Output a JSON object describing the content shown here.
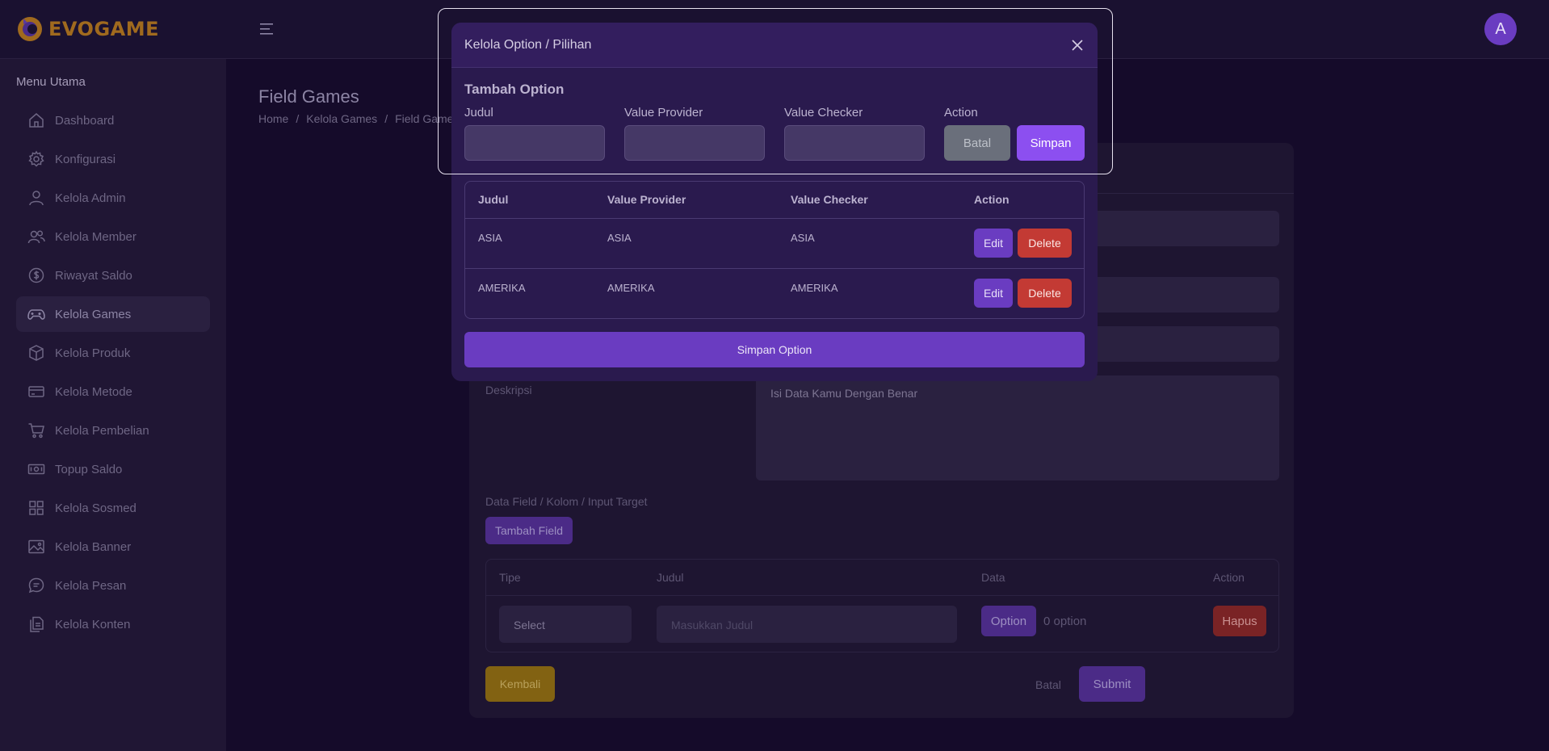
{
  "brand": {
    "name": "EVOGAME"
  },
  "user": {
    "avatar_letter": "A"
  },
  "sidebar": {
    "title": "Menu Utama",
    "items": [
      {
        "label": "Dashboard",
        "icon": "home-icon"
      },
      {
        "label": "Konfigurasi",
        "icon": "gear-icon"
      },
      {
        "label": "Kelola Admin",
        "icon": "user-icon"
      },
      {
        "label": "Kelola Member",
        "icon": "users-icon"
      },
      {
        "label": "Riwayat Saldo",
        "icon": "dollar-icon"
      },
      {
        "label": "Kelola Games",
        "icon": "gamepad-icon",
        "active": true
      },
      {
        "label": "Kelola Produk",
        "icon": "box-icon"
      },
      {
        "label": "Kelola Metode",
        "icon": "card-icon"
      },
      {
        "label": "Kelola Pembelian",
        "icon": "cart-icon"
      },
      {
        "label": "Topup Saldo",
        "icon": "cash-icon"
      },
      {
        "label": "Kelola Sosmed",
        "icon": "grid-icon"
      },
      {
        "label": "Kelola Banner",
        "icon": "image-icon"
      },
      {
        "label": "Kelola Pesan",
        "icon": "chat-icon"
      },
      {
        "label": "Kelola Konten",
        "icon": "files-icon"
      }
    ]
  },
  "page": {
    "title": "Field Games",
    "breadcrumb": [
      "Home",
      "Kelola Games",
      "Field Games"
    ]
  },
  "form": {
    "deskripsi_label": "Deskripsi",
    "deskripsi_value": "Isi Data Kamu Dengan Benar",
    "field_section_label": "Data Field / Kolom / Input Target",
    "tambah_field": "Tambah Field",
    "field_table": {
      "headers": [
        "Tipe",
        "Judul",
        "Data",
        "Action"
      ],
      "row": {
        "tipe": "Select",
        "judul_placeholder": "Masukkan Judul",
        "option_button": "Option",
        "option_count": "0 option",
        "hapus": "Hapus"
      }
    },
    "kembali": "Kembali",
    "batal": "Batal",
    "submit": "Submit"
  },
  "modal": {
    "title": "Kelola Option / Pilihan",
    "subtitle": "Tambah Option",
    "labels": [
      "Judul",
      "Value Provider",
      "Value Checker",
      "Action"
    ],
    "batal": "Batal",
    "simpan": "Simpan",
    "table": {
      "headers": [
        "Judul",
        "Value Provider",
        "Value Checker",
        "Action"
      ],
      "rows": [
        {
          "judul": "ASIA",
          "provider": "ASIA",
          "checker": "ASIA"
        },
        {
          "judul": "AMERIKA",
          "provider": "AMERIKA",
          "checker": "AMERIKA"
        }
      ],
      "edit": "Edit",
      "delete": "Delete"
    },
    "simpan_option": "Simpan Option"
  }
}
